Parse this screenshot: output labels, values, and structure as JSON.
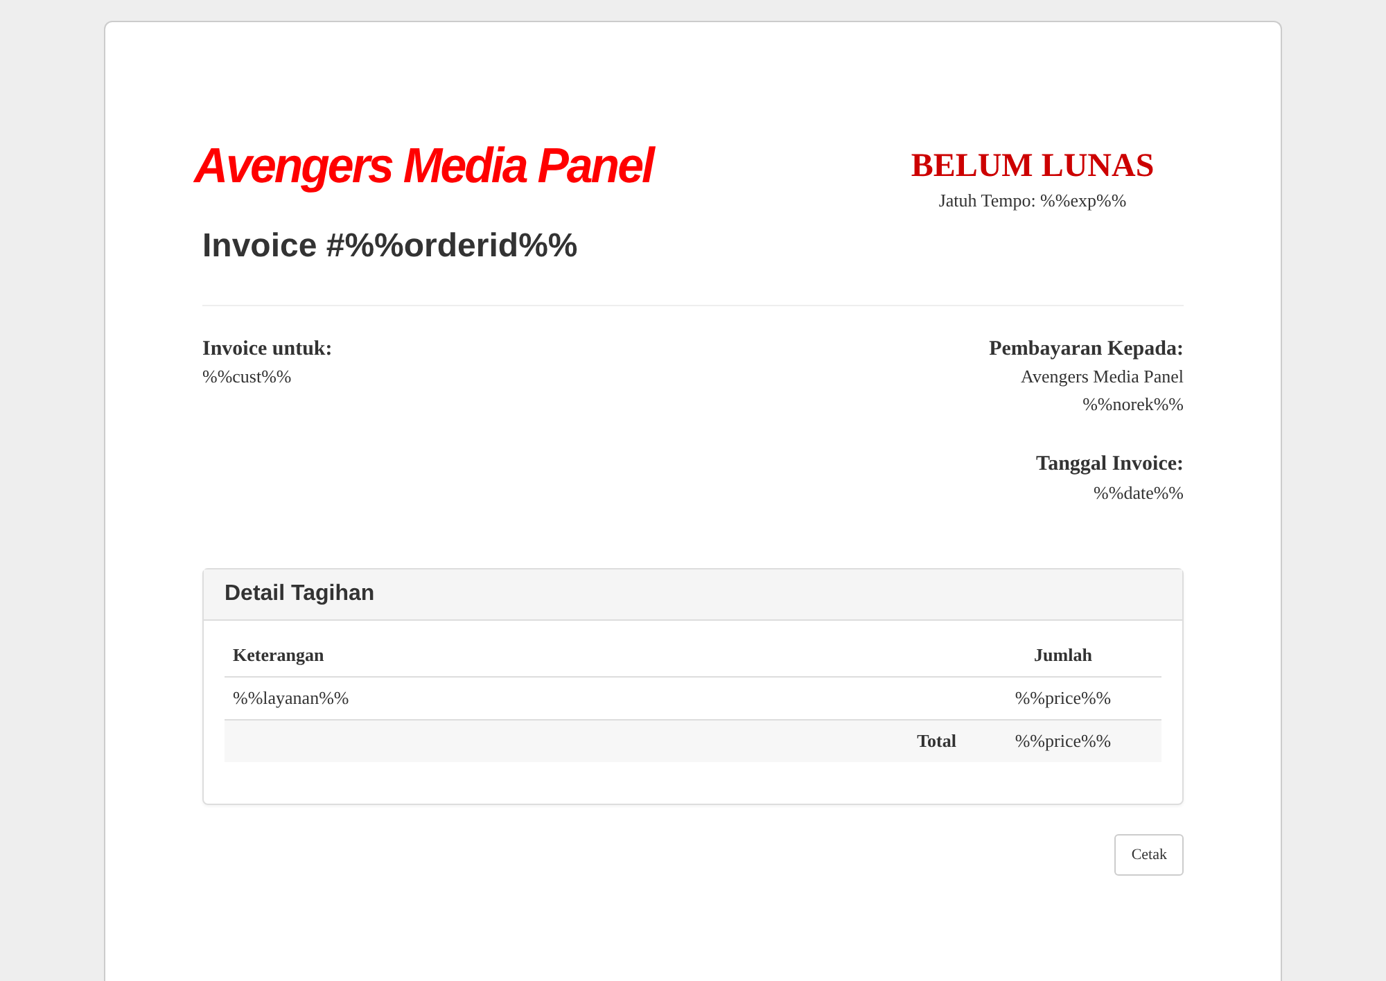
{
  "logo": "Avengers Media Panel",
  "invoice_title": "Invoice #%%orderid%%",
  "status": {
    "label": "BELUM LUNAS",
    "due": "Jatuh Tempo: %%exp%%"
  },
  "bill_to": {
    "heading": "Invoice untuk:",
    "lines": [
      "%%cust%%"
    ]
  },
  "pay_to": {
    "heading": "Pembayaran Kepada:",
    "lines": [
      "Avengers Media Panel",
      "%%norek%%"
    ]
  },
  "invoice_date": {
    "heading": "Tanggal Invoice:",
    "lines": [
      "%%date%%"
    ]
  },
  "panel": {
    "title": "Detail Tagihan",
    "columns": [
      "Keterangan",
      "Jumlah"
    ],
    "rows": [
      {
        "description": "%%layanan%%",
        "amount": "%%price%%"
      }
    ],
    "total": {
      "label": "Total",
      "amount": "%%price%%"
    }
  },
  "buttons": [
    "Cetak"
  ]
}
